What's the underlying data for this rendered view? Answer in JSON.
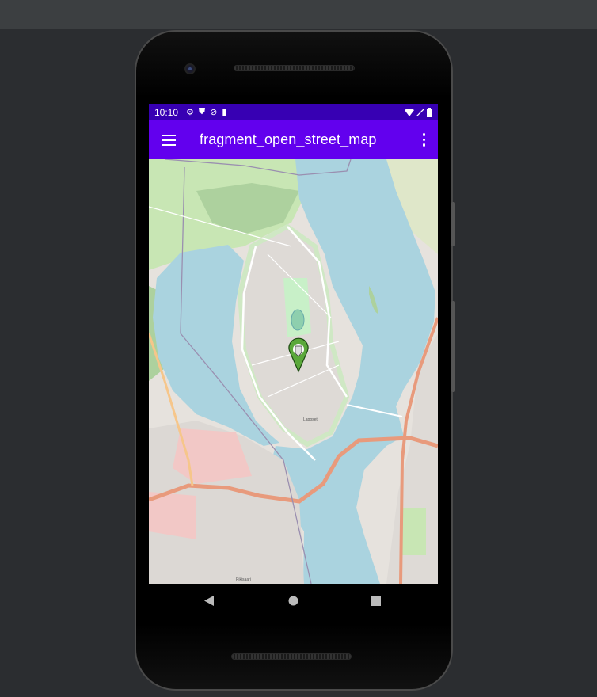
{
  "status_bar": {
    "time": "10:10",
    "icons": [
      "gear-icon",
      "shield-play-icon",
      "no-sync-icon",
      "sd-card-icon"
    ],
    "right_icons": [
      "wifi-icon",
      "signal-icon",
      "battery-icon"
    ]
  },
  "app_bar": {
    "title": "fragment_open_street_map",
    "menu_icon": "hamburger-icon",
    "overflow_icon": "more-vert-icon",
    "color": "#6200ee",
    "status_color": "#3700b3"
  },
  "map": {
    "water_color": "#aad3df",
    "marker_color": "#5aa83a",
    "labels": [
      "Lappset",
      "Pikisaari"
    ]
  },
  "nav_bar": {
    "buttons": [
      "back",
      "home",
      "recents"
    ]
  }
}
